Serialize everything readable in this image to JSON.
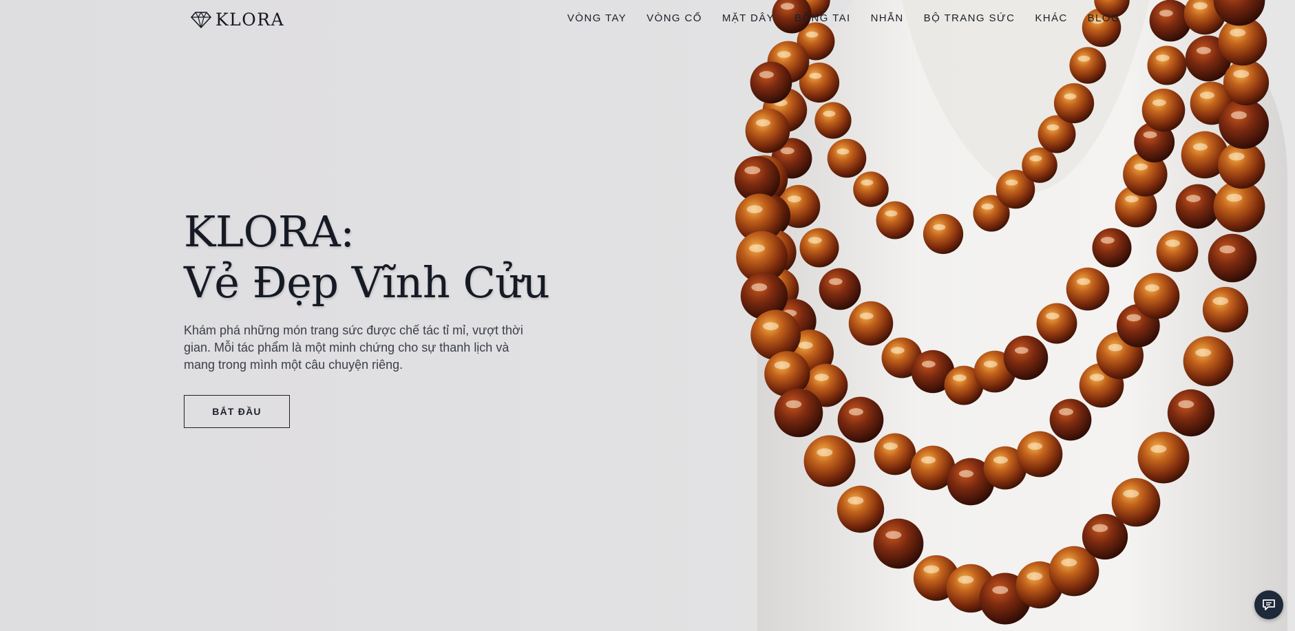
{
  "brand": {
    "name": "KLORA",
    "logo_icon": "diamond-icon"
  },
  "nav": {
    "items": [
      {
        "label": "VÒNG TAY"
      },
      {
        "label": "VÒNG CỔ"
      },
      {
        "label": "MẶT DÂY"
      },
      {
        "label": "BÔNG TAI"
      },
      {
        "label": "NHẪN"
      },
      {
        "label": "BỘ TRANG SỨC"
      },
      {
        "label": "KHÁC"
      },
      {
        "label": "BLOG"
      }
    ]
  },
  "hero": {
    "title_line1": "KLORA:",
    "title_line2": "Vẻ Đẹp Vĩnh Cửu",
    "description": "Khám phá những món trang sức được chế tác tỉ mỉ, vượt thời gian. Mỗi tác phẩm là một minh chứng cho sự thanh lịch và mang trong mình một câu chuyện riêng.",
    "cta_label": "BẮT ĐẦU",
    "image_subject": "amber-bead-necklace-on-bust"
  },
  "chat": {
    "icon": "chat-icon"
  },
  "colors": {
    "background": "#e0dfe1",
    "text_dark": "#151a25",
    "amber": "#b4501a",
    "chat_button": "#1e2a3a"
  }
}
